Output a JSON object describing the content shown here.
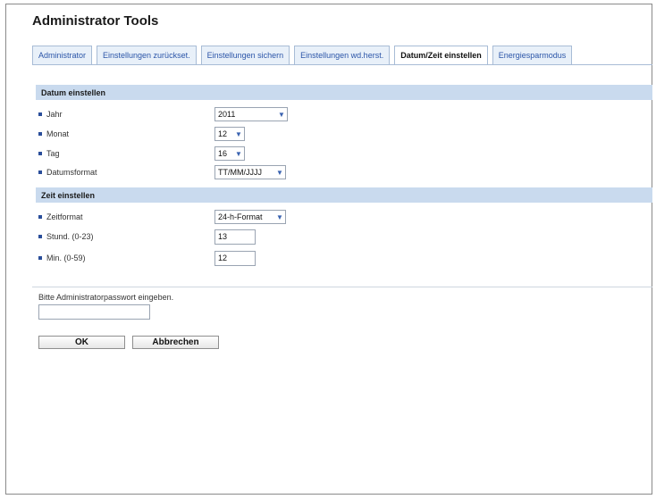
{
  "page": {
    "title": "Administrator Tools"
  },
  "tabs": [
    {
      "label": "Administrator"
    },
    {
      "label": "Einstellungen zurückset."
    },
    {
      "label": "Einstellungen sichern"
    },
    {
      "label": "Einstellungen wd.herst."
    },
    {
      "label": "Datum/Zeit einstellen",
      "active": true
    },
    {
      "label": "Energiesparmodus"
    }
  ],
  "date_section": {
    "header": "Datum einstellen",
    "year": {
      "label": "Jahr",
      "value": "2011"
    },
    "month": {
      "label": "Monat",
      "value": "12"
    },
    "day": {
      "label": "Tag",
      "value": "16"
    },
    "format": {
      "label": "Datumsformat",
      "value": "TT/MM/JJJJ"
    }
  },
  "time_section": {
    "header": "Zeit einstellen",
    "format": {
      "label": "Zeitformat",
      "value": "24-h-Format"
    },
    "hour": {
      "label": "Stund. (0-23)",
      "value": "13"
    },
    "minute": {
      "label": "Min. (0-59)",
      "value": "12"
    }
  },
  "password": {
    "label": "Bitte Administratorpasswort eingeben.",
    "value": ""
  },
  "buttons": {
    "ok": "OK",
    "cancel": "Abbrechen"
  },
  "colors": {
    "accent": "#2b55a8",
    "header_bg": "#c9daee",
    "tab_bg": "#e8f0f9"
  }
}
